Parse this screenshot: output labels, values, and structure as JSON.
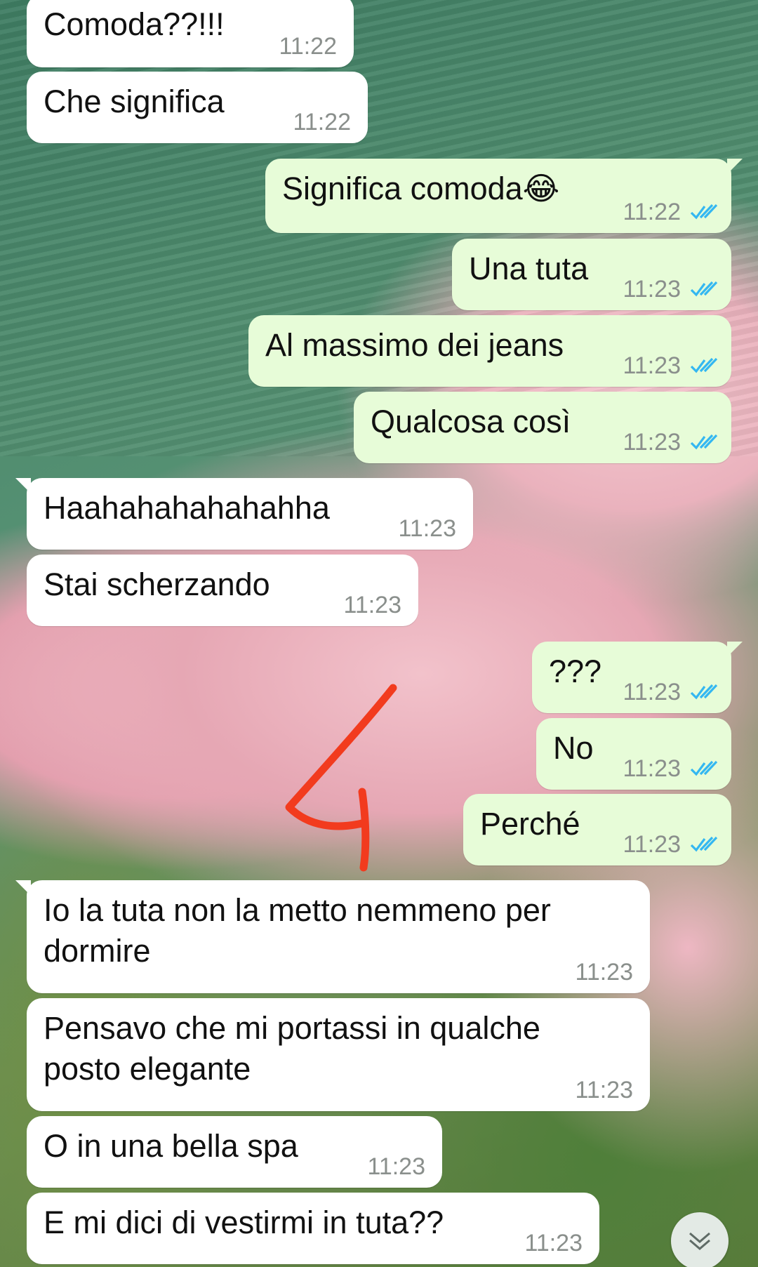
{
  "messages": [
    {
      "text": "Comoda??!!!",
      "time": "11:22",
      "direction": "incoming"
    },
    {
      "text": "Che significa",
      "time": "11:22",
      "direction": "incoming"
    },
    {
      "text": "Significa comoda😂",
      "time": "11:22",
      "direction": "outgoing",
      "status": "read"
    },
    {
      "text": "Una tuta",
      "time": "11:23",
      "direction": "outgoing",
      "status": "read"
    },
    {
      "text": "Al massimo dei jeans",
      "time": "11:23",
      "direction": "outgoing",
      "status": "read"
    },
    {
      "text": "Qualcosa così",
      "time": "11:23",
      "direction": "outgoing",
      "status": "read"
    },
    {
      "text": "Haahahahahahahha",
      "time": "11:23",
      "direction": "incoming"
    },
    {
      "text": "Stai scherzando",
      "time": "11:23",
      "direction": "incoming"
    },
    {
      "text": "???",
      "time": "11:23",
      "direction": "outgoing",
      "status": "read"
    },
    {
      "text": "No",
      "time": "11:23",
      "direction": "outgoing",
      "status": "read"
    },
    {
      "text": "Perché",
      "time": "11:23",
      "direction": "outgoing",
      "status": "read"
    },
    {
      "text": "Io la tuta non la metto nemmeno per dormire",
      "time": "11:23",
      "direction": "incoming"
    },
    {
      "text": "Pensavo che mi portassi in qualche posto elegante",
      "time": "11:23",
      "direction": "incoming"
    },
    {
      "text": "O in una bella spa",
      "time": "11:23",
      "direction": "incoming"
    },
    {
      "text": "E mi dici di vestirmi in tuta??",
      "time": "11:23",
      "direction": "incoming"
    }
  ],
  "annotation_text": "4",
  "colors": {
    "incoming_bubble": "#ffffff",
    "outgoing_bubble": "#e7fcd8",
    "read_ticks": "#34b7f1",
    "timestamp": "#8a8f8c",
    "annotation": "#f23b1e"
  },
  "icons": {
    "read_status": "double-check-icon",
    "scroll_down": "double-chevron-down-icon"
  }
}
